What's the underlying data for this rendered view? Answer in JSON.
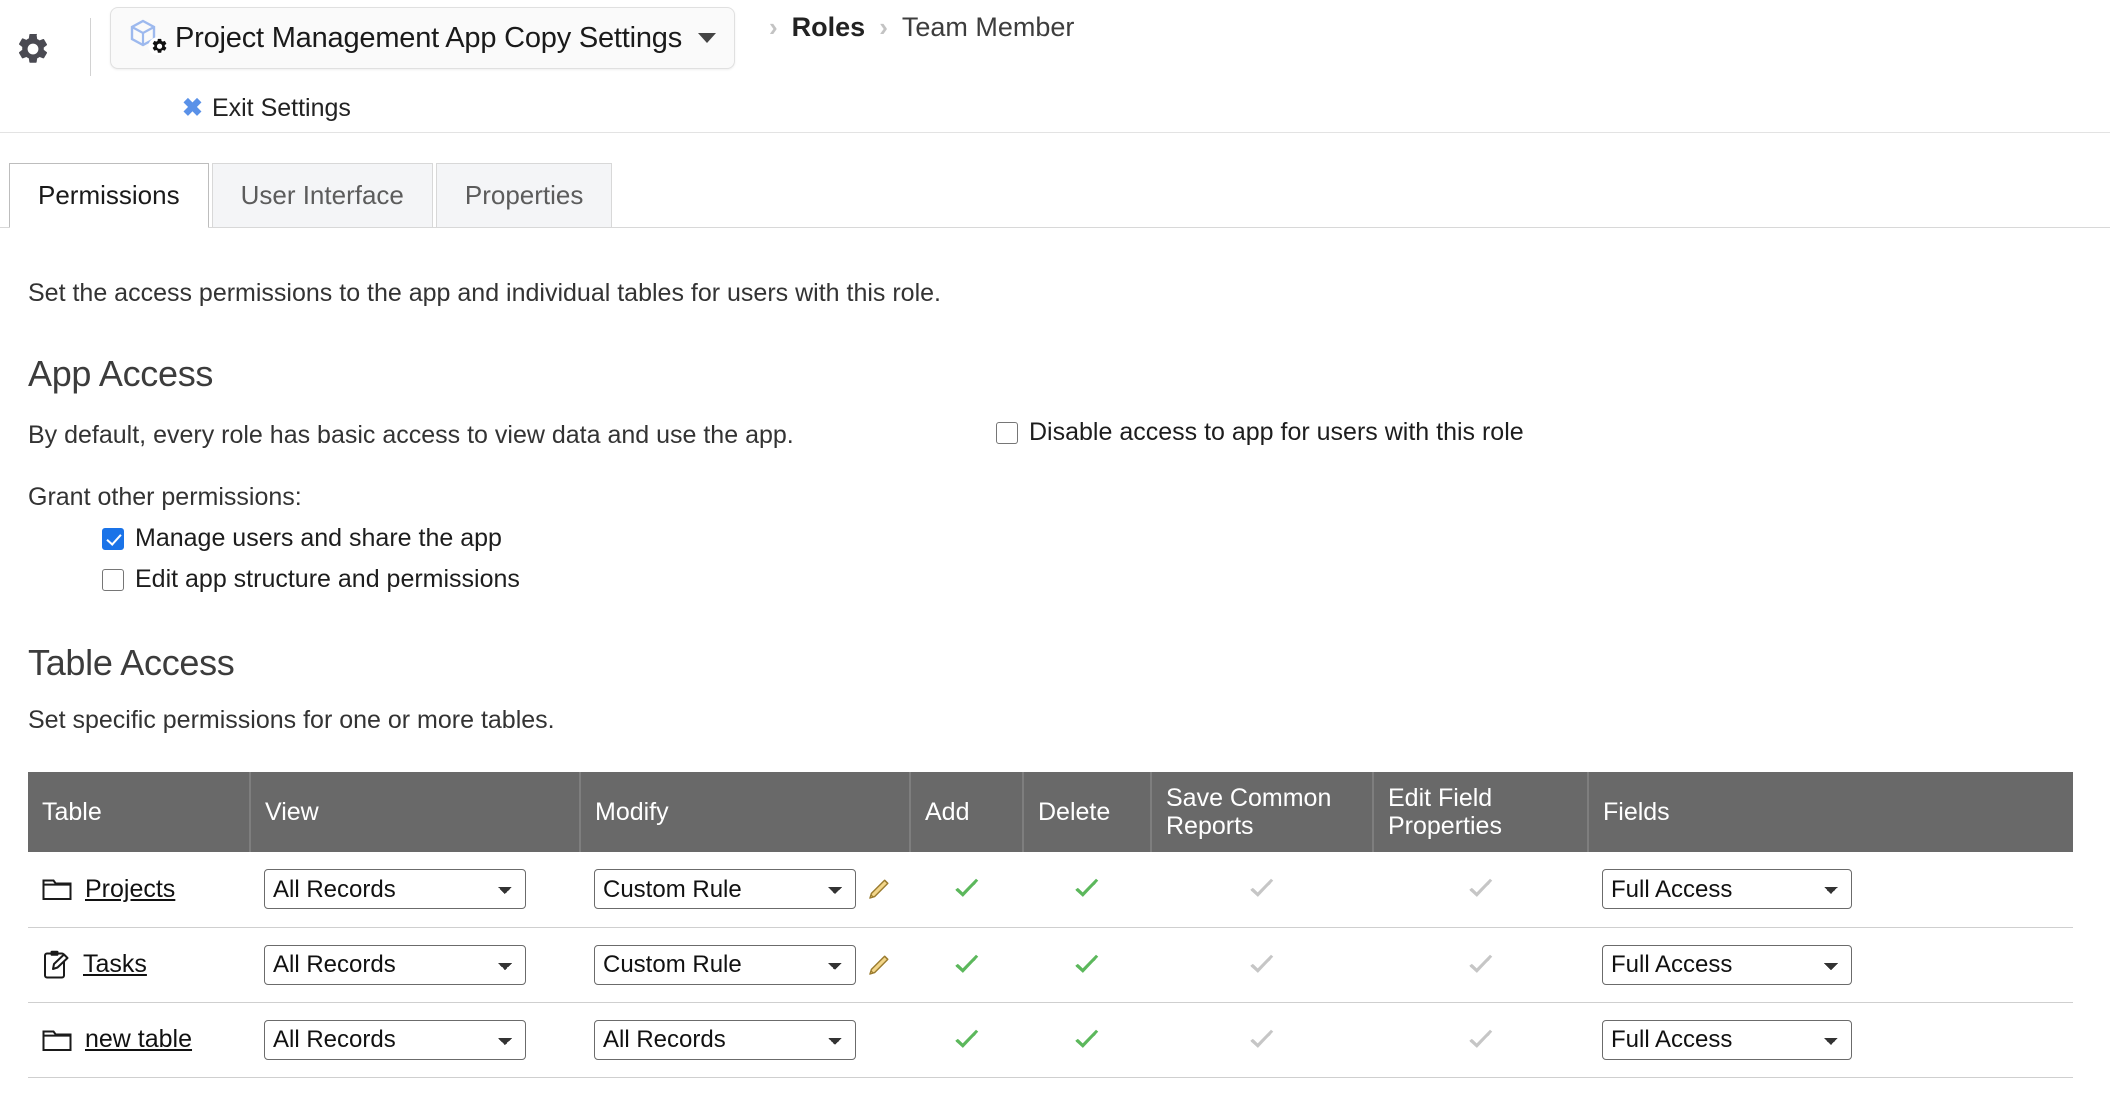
{
  "topbar": {
    "gear_icon": "gear-icon",
    "app_icon": "app-cube-gear-icon",
    "app_title": "Project Management App Copy Settings",
    "caret_icon": "chevron-down-icon",
    "exit_label": "Exit Settings",
    "exit_icon": "close-x-icon",
    "breadcrumb": [
      {
        "label": "Roles",
        "strong": true
      },
      {
        "label": "Team Member",
        "strong": false
      }
    ],
    "breadcrumb_separator": "›"
  },
  "tabs": [
    {
      "label": "Permissions",
      "active": true
    },
    {
      "label": "User Interface",
      "active": false
    },
    {
      "label": "Properties",
      "active": false
    }
  ],
  "main": {
    "intro": "Set the access permissions to the app and individual tables for users with this role.",
    "app_access": {
      "heading": "App Access",
      "default_text": "By default, every role has basic access to view data and use the app.",
      "disable_checkbox": {
        "label": "Disable access to app for users with this role",
        "checked": false
      },
      "grant_label": "Grant other permissions:",
      "permissions": [
        {
          "label": "Manage users and share the app",
          "checked": true
        },
        {
          "label": "Edit app structure and permissions",
          "checked": false
        }
      ]
    },
    "table_access": {
      "heading": "Table Access",
      "subtitle": "Set specific permissions for one or more tables.",
      "columns": [
        "Table",
        "View",
        "Modify",
        "Add",
        "Delete",
        "Save Common Reports",
        "Edit Field Properties",
        "Fields"
      ],
      "rows": [
        {
          "icon": "folder-icon",
          "name": "Projects",
          "view": "All Records",
          "modify": "Custom Rule",
          "modify_edit_icon": "pencil-icon",
          "add": "check-green",
          "delete": "check-green",
          "save_common_reports": "check-gray",
          "edit_field_properties": "check-gray",
          "fields": "Full Access"
        },
        {
          "icon": "clipboard-pen-icon",
          "name": "Tasks",
          "view": "All Records",
          "modify": "Custom Rule",
          "modify_edit_icon": "pencil-icon",
          "add": "check-green",
          "delete": "check-green",
          "save_common_reports": "check-gray",
          "edit_field_properties": "check-gray",
          "fields": "Full Access"
        },
        {
          "icon": "folder-icon",
          "name": "new table",
          "view": "All Records",
          "modify": "All Records",
          "modify_edit_icon": null,
          "add": "check-green",
          "delete": "check-green",
          "save_common_reports": "check-gray",
          "edit_field_properties": "check-gray",
          "fields": "Full Access"
        }
      ]
    }
  },
  "colors": {
    "header_bg": "#696969",
    "check_green": "#5cb85c",
    "check_gray": "#bdbdbd",
    "checkbox_blue": "#1a73e8",
    "link_blue": "#5a91e8"
  }
}
